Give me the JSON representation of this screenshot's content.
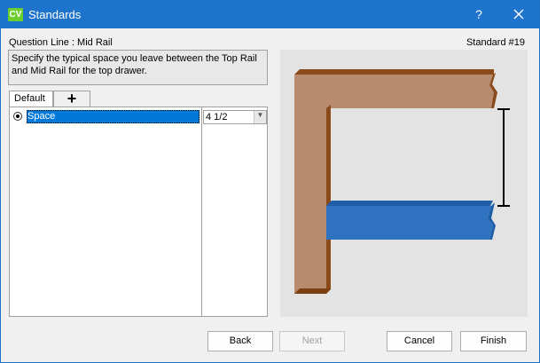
{
  "window": {
    "app_icon_text": "CV",
    "title": "Standards",
    "help_label": "?"
  },
  "header": {
    "question_line": "Question Line : Mid Rail",
    "standard_number": "Standard #19"
  },
  "description": "Specify the typical space you leave between the Top Rail and Mid Rail for the top drawer.",
  "tabs": [
    {
      "label": "Default",
      "selected": true
    },
    {
      "label": "+",
      "icon": "plus-icon"
    }
  ],
  "rows": [
    {
      "label": "Space",
      "value": "4 1/2",
      "selected": true
    }
  ],
  "buttons": {
    "back": "Back",
    "next": "Next",
    "cancel": "Cancel",
    "finish": "Finish"
  },
  "colors": {
    "titlebar": "#1e73cc",
    "selection": "#0078d7",
    "wood": "#b88a6e",
    "wood_dark": "#7a4012",
    "mid_rail": "#2f73c0"
  }
}
